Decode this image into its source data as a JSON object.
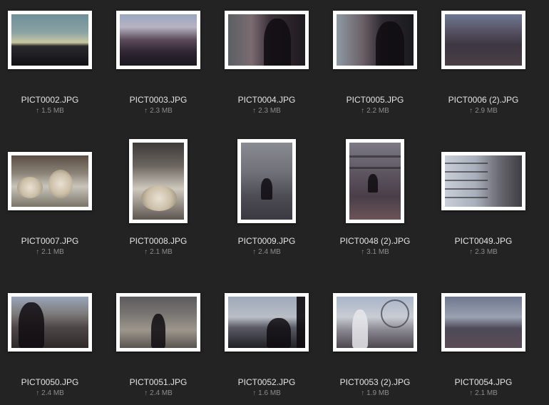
{
  "files": [
    {
      "name": "PICT0002.JPG",
      "size": "1.5 MB",
      "thumb": "sky",
      "icon": "upload-arrow-icon"
    },
    {
      "name": "PICT0003.JPG",
      "size": "2.3 MB",
      "thumb": "market",
      "icon": "upload-arrow-icon"
    },
    {
      "name": "PICT0004.JPG",
      "size": "2.3 MB",
      "thumb": "couple",
      "icon": "upload-arrow-icon"
    },
    {
      "name": "PICT0005.JPG",
      "size": "2.2 MB",
      "thumb": "couple2",
      "icon": "upload-arrow-icon"
    },
    {
      "name": "PICT0006 (2).JPG",
      "size": "2.9 MB",
      "thumb": "street",
      "icon": "upload-arrow-icon"
    },
    {
      "name": "PICT0007.JPG",
      "size": "2.1 MB",
      "thumb": "coffee",
      "icon": "upload-arrow-icon"
    },
    {
      "name": "PICT0008.JPG",
      "size": "2.1 MB",
      "thumb": "coffee2",
      "icon": "upload-arrow-icon"
    },
    {
      "name": "PICT0009.JPG",
      "size": "2.4 MB",
      "thumb": "stairs",
      "icon": "upload-arrow-icon"
    },
    {
      "name": "PICT0048 (2).JPG",
      "size": "3.1 MB",
      "thumb": "bridge",
      "icon": "upload-arrow-icon"
    },
    {
      "name": "PICT0049.JPG",
      "size": "2.3 MB",
      "thumb": "walk",
      "icon": "upload-arrow-icon"
    },
    {
      "name": "PICT0050.JPG",
      "size": "2.4 MB",
      "thumb": "house",
      "icon": "upload-arrow-icon"
    },
    {
      "name": "PICT0051.JPG",
      "size": "2.4 MB",
      "thumb": "yard",
      "icon": "upload-arrow-icon"
    },
    {
      "name": "PICT0052.JPG",
      "size": "1.6 MB",
      "thumb": "river",
      "icon": "upload-arrow-icon"
    },
    {
      "name": "PICT0053 (2).JPG",
      "size": "1.9 MB",
      "thumb": "eye",
      "icon": "upload-arrow-icon"
    },
    {
      "name": "PICT0054.JPG",
      "size": "2.1 MB",
      "thumb": "thames",
      "icon": "upload-arrow-icon"
    }
  ],
  "upload_arrow_glyph": "↑",
  "colors": {
    "background": "#232323",
    "filename_text": "#e4e4e4",
    "size_text": "#8c8c8c",
    "frame": "#ffffff"
  }
}
